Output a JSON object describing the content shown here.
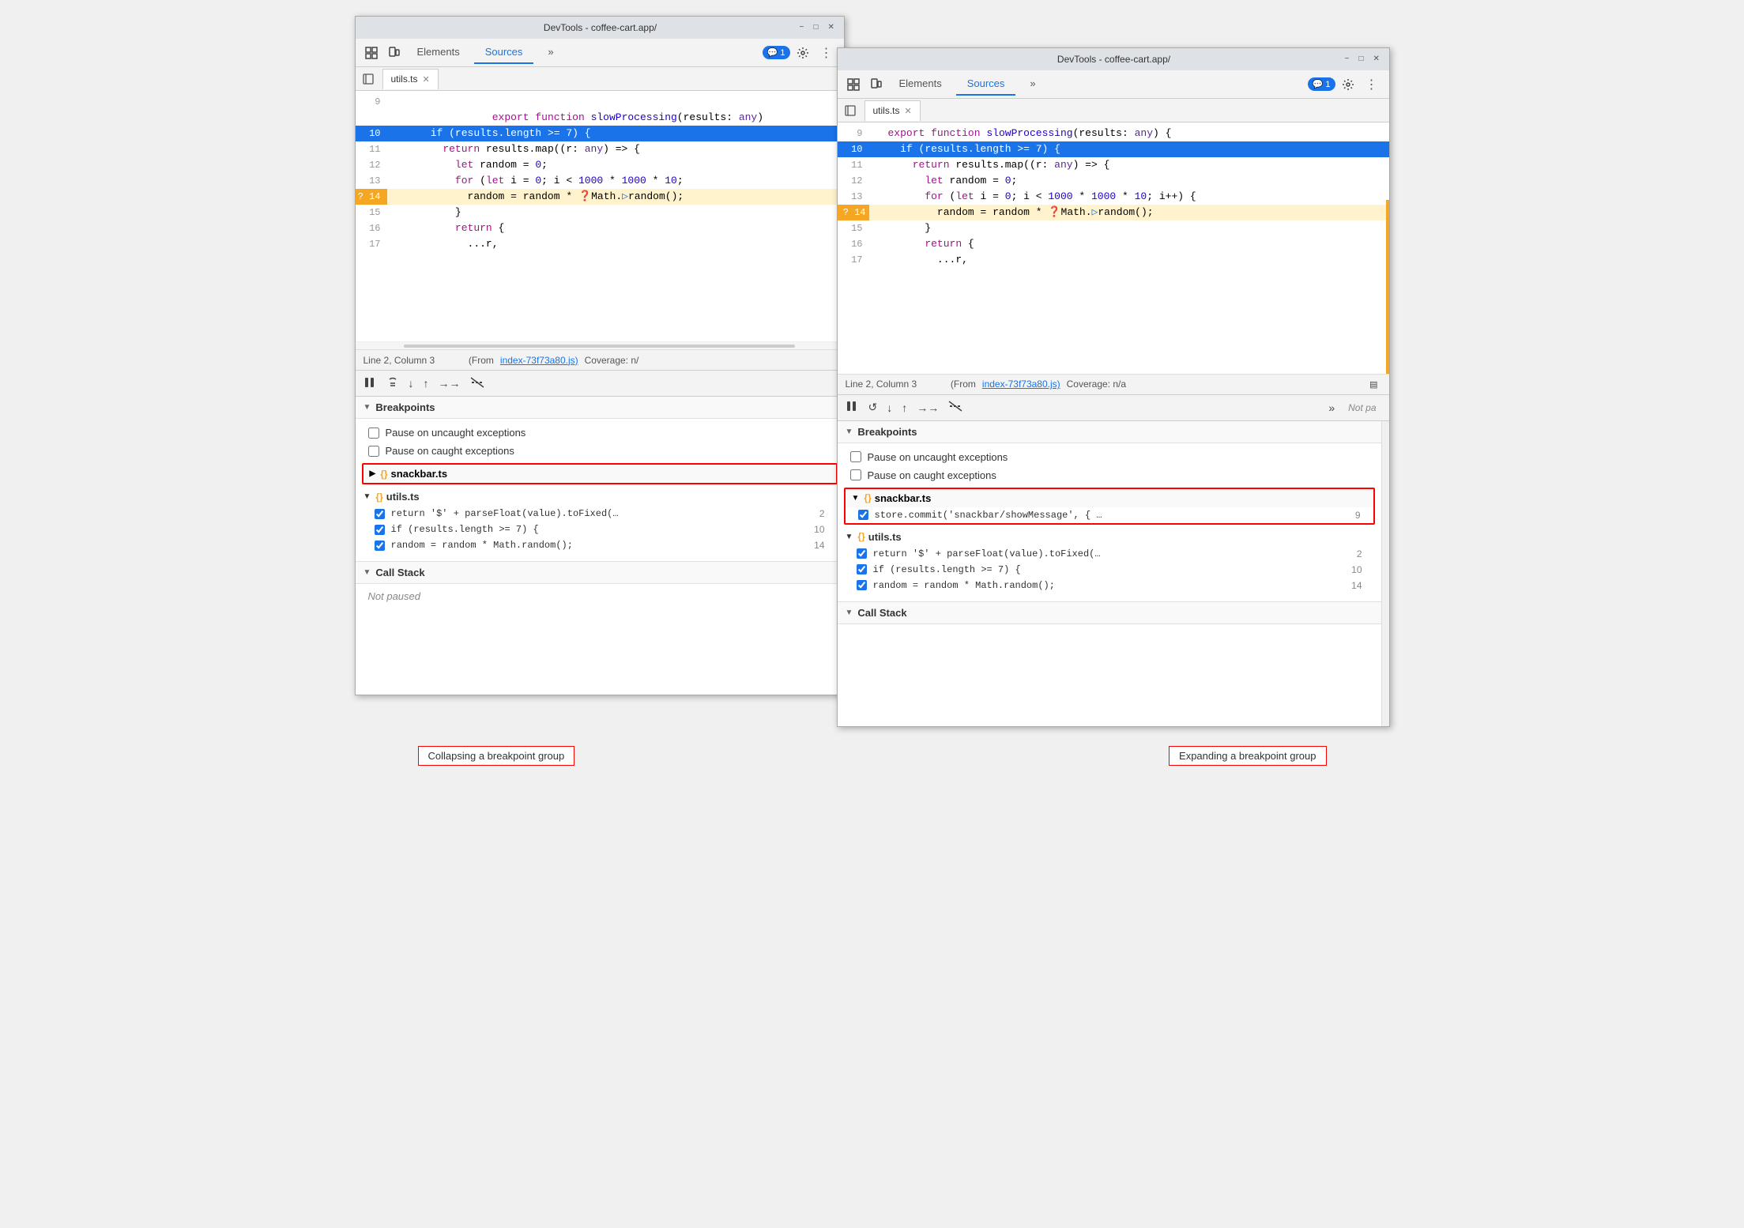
{
  "window1": {
    "title": "DevTools - coffee-cart.app/",
    "tabs": [
      "Elements",
      "Sources"
    ],
    "active_tab": "Sources",
    "badge": "1",
    "file_tab": "utils.ts",
    "code_lines": [
      {
        "num": 9,
        "content": "export function slowProcessing(results: any)",
        "highlight": false,
        "bp": false
      },
      {
        "num": 10,
        "content": "  if (results.length >= 7) {",
        "highlight": true,
        "bp": false
      },
      {
        "num": 11,
        "content": "    return results.map((r: any) => {",
        "highlight": false,
        "bp": false
      },
      {
        "num": 12,
        "content": "      let random = 0;",
        "highlight": false,
        "bp": false
      },
      {
        "num": 13,
        "content": "      for (let i = 0; i < 1000 * 1000 * 10;",
        "highlight": false,
        "bp": false
      },
      {
        "num": 14,
        "content": "        random = random * ❓Math.▷random();",
        "highlight": false,
        "bp": true
      },
      {
        "num": 15,
        "content": "      }",
        "highlight": false,
        "bp": false
      },
      {
        "num": 16,
        "content": "      return {",
        "highlight": false,
        "bp": false
      },
      {
        "num": 17,
        "content": "        ...r,",
        "highlight": false,
        "bp": false
      }
    ],
    "status": {
      "position": "Line 2, Column 3",
      "from_text": "(From",
      "from_link": "index-73f73a80.js)",
      "coverage": "Coverage: n/"
    },
    "breakpoints": {
      "header": "Breakpoints",
      "exceptions": [
        "Pause on uncaught exceptions",
        "Pause on caught exceptions"
      ],
      "groups": [
        {
          "name": "snackbar.ts",
          "expanded": false,
          "items": []
        },
        {
          "name": "utils.ts",
          "expanded": true,
          "items": [
            {
              "code": "return '$' + parseFloat(value).toFixed(…",
              "line": "2"
            },
            {
              "code": "if (results.length >= 7) {",
              "line": "10"
            },
            {
              "code": "random = random * Math.random();",
              "line": "14"
            }
          ]
        }
      ]
    },
    "callstack": {
      "header": "Call Stack",
      "content": "Not paused"
    }
  },
  "window2": {
    "title": "DevTools - coffee-cart.app/",
    "tabs": [
      "Elements",
      "Sources"
    ],
    "active_tab": "Sources",
    "badge": "1",
    "file_tab": "utils.ts",
    "code_lines": [
      {
        "num": 9,
        "content": "export function slowProcessing(results: any) {",
        "highlight": false,
        "bp": false
      },
      {
        "num": 10,
        "content": "  if (results.length >= 7) {",
        "highlight": true,
        "bp": false
      },
      {
        "num": 11,
        "content": "    return results.map((r: any) => {",
        "highlight": false,
        "bp": false
      },
      {
        "num": 12,
        "content": "      let random = 0;",
        "highlight": false,
        "bp": false
      },
      {
        "num": 13,
        "content": "      for (let i = 0; i < 1000 * 1000 * 10; i++) {",
        "highlight": false,
        "bp": false
      },
      {
        "num": 14,
        "content": "        random = random * ❓Math.▷random();",
        "highlight": false,
        "bp": true
      },
      {
        "num": 15,
        "content": "      }",
        "highlight": false,
        "bp": false
      },
      {
        "num": 16,
        "content": "      return {",
        "highlight": false,
        "bp": false
      },
      {
        "num": 17,
        "content": "        ...r,",
        "highlight": false,
        "bp": false
      }
    ],
    "status": {
      "position": "Line 2, Column 3",
      "from_text": "(From",
      "from_link": "index-73f73a80.js)",
      "coverage": "Coverage: n/a"
    },
    "breakpoints": {
      "header": "Breakpoints",
      "exceptions": [
        "Pause on uncaught exceptions",
        "Pause on caught exceptions"
      ],
      "groups": [
        {
          "name": "snackbar.ts",
          "expanded": true,
          "items": [
            {
              "code": "store.commit('snackbar/showMessage', { …",
              "line": "9"
            }
          ]
        },
        {
          "name": "utils.ts",
          "expanded": true,
          "items": [
            {
              "code": "return '$' + parseFloat(value).toFixed(…",
              "line": "2"
            },
            {
              "code": "if (results.length >= 7) {",
              "line": "10"
            },
            {
              "code": "random = random * Math.random();",
              "line": "14"
            }
          ]
        }
      ]
    },
    "callstack": {
      "header": "Call Stack"
    },
    "right_note": "Not pa"
  },
  "captions": {
    "left": "Collapsing a breakpoint group",
    "right": "Expanding a breakpoint group"
  }
}
